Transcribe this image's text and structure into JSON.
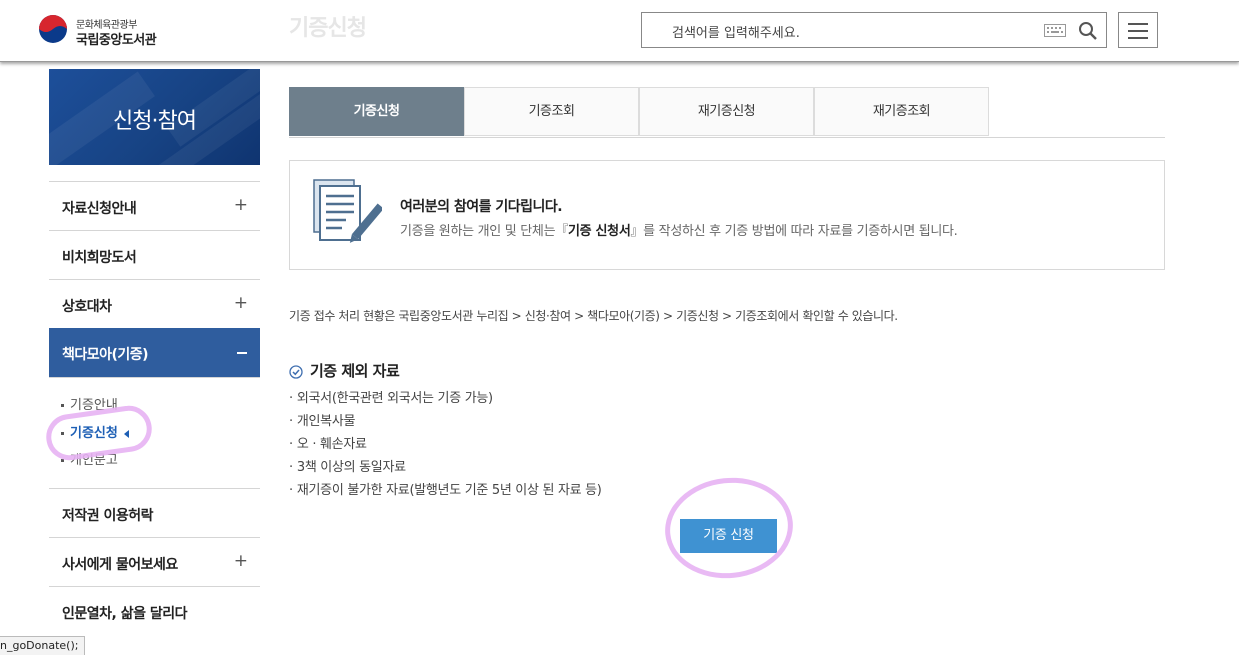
{
  "header": {
    "logo_line1": "문화체육관광부",
    "logo_line2": "국립중앙도서관",
    "ghost_title": "기증신청",
    "search_placeholder": "검색어를 입력해주세요.",
    "keyboard_icon": "keyboard-icon",
    "search_icon": "search-icon",
    "menu_icon": "hamburger-icon"
  },
  "sidebar": {
    "banner_title": "신청·참여",
    "items": [
      {
        "label": "자료신청안내",
        "expand": "+"
      },
      {
        "label": "비치희망도서",
        "expand": ""
      },
      {
        "label": "상호대차",
        "expand": "+"
      },
      {
        "label": "책다모아(기증)",
        "expand": "–"
      },
      {
        "label": "저작권 이용허락",
        "expand": ""
      },
      {
        "label": "사서에게 물어보세요",
        "expand": "+"
      },
      {
        "label": "인문열차, 삶을 달리다",
        "expand": ""
      }
    ],
    "sub_items": [
      "기증안내",
      "기증신청",
      "개인문고"
    ]
  },
  "tabs": [
    "기증신청",
    "기증조회",
    "재기증신청",
    "재기증조회"
  ],
  "intro": {
    "heading": "여러분의 참여를 기다립니다.",
    "text_before": "기증을 원하는 개인 및 단체는『",
    "text_bold": "기증 신청서",
    "text_after": "』를 작성하신 후 기증 방법에 따라 자료를 기증하시면 됩니다."
  },
  "notice": "기증 접수 처리 현황은 국립중앙도서관 누리집 > 신청·참여 > 책다모아(기증) > 기증신청 > 기증조회에서 확인할 수 있습니다.",
  "exclusion": {
    "title": "기증 제외 자료",
    "items": [
      "외국서(한국관련 외국서는 기증 가능)",
      "개인복사물",
      "오 · 훼손자료",
      "3책 이상의 동일자료",
      "재기증이 불가한 자료(발행년도 기준 5년 이상 된 자료 등)"
    ]
  },
  "apply_button": "기증 신청",
  "statusbar": "n_goDonate();",
  "colors": {
    "active_nav": "#2f5d9e",
    "active_tab": "#6e7f8c",
    "button": "#3f92d2",
    "highlight": "#e7b3f3"
  }
}
